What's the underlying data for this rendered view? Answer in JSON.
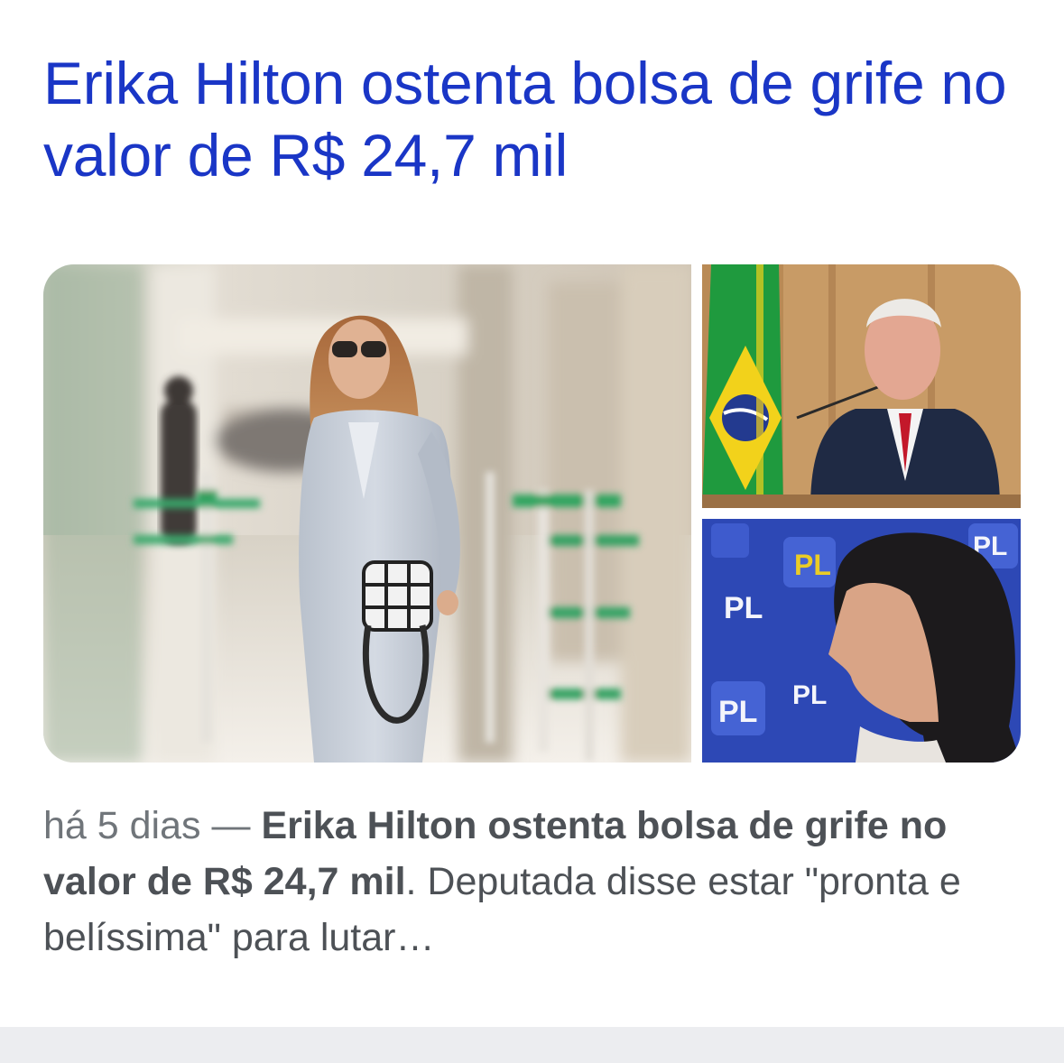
{
  "result": {
    "headline": "Erika Hilton ostenta bolsa de grife no valor de R$ 24,7 mil",
    "snippet": {
      "date": "há 5 dias",
      "separator": " — ",
      "bold_text": "Erika Hilton ostenta bolsa de grife no valor de R$ 24,7 mil",
      "rest_text": ". Deputada disse estar \"pronta e belíssima\" para lutar…"
    },
    "images": {
      "flag_colors": {
        "green": "#1f9a3e",
        "yellow": "#f2d21b",
        "blue": "#233a8f"
      },
      "logo_text": "PL"
    }
  },
  "colors": {
    "link": "#1a36c6",
    "snippet_text": "#4d5156",
    "date_text": "#70757a",
    "footer_bar": "#ecedf0"
  }
}
